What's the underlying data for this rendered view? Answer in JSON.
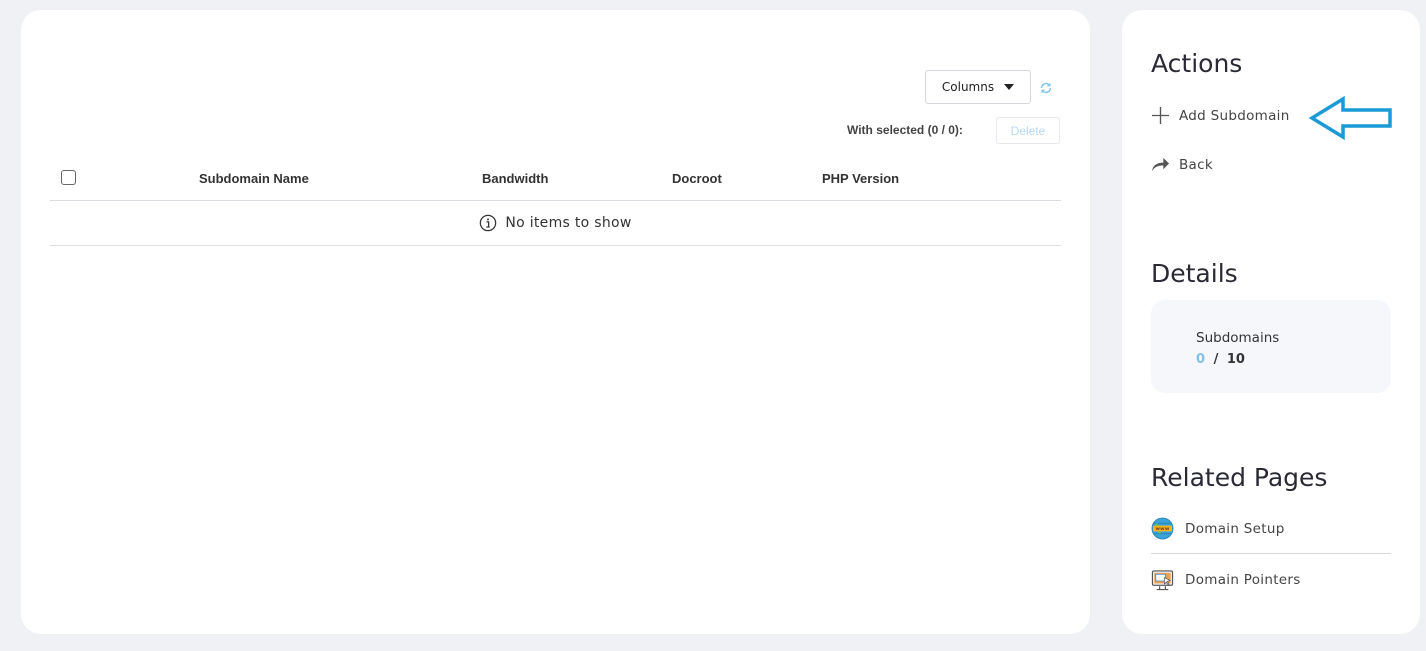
{
  "toolbar": {
    "columns_label": "Columns",
    "with_selected_label": "With selected (0 / 0):",
    "delete_label": "Delete"
  },
  "table": {
    "columns": [
      "Subdomain Name",
      "Bandwidth",
      "Docroot",
      "PHP Version"
    ],
    "empty_message": "No items to show"
  },
  "sidebar": {
    "actions_title": "Actions",
    "actions": [
      {
        "label": "Add Subdomain",
        "icon": "plus-icon"
      },
      {
        "label": "Back",
        "icon": "back-arrow-icon"
      }
    ],
    "details_title": "Details",
    "details": {
      "label": "Subdomains",
      "used": "0",
      "separator": "/",
      "limit": "10"
    },
    "related_title": "Related Pages",
    "related": [
      {
        "label": "Domain Setup",
        "icon": "globe-www-icon"
      },
      {
        "label": "Domain Pointers",
        "icon": "monitor-pointer-icon"
      }
    ]
  },
  "colors": {
    "accent": "#7fc2ea",
    "annotation_arrow": "#1a9ad6",
    "background": "#f0f1f5"
  }
}
